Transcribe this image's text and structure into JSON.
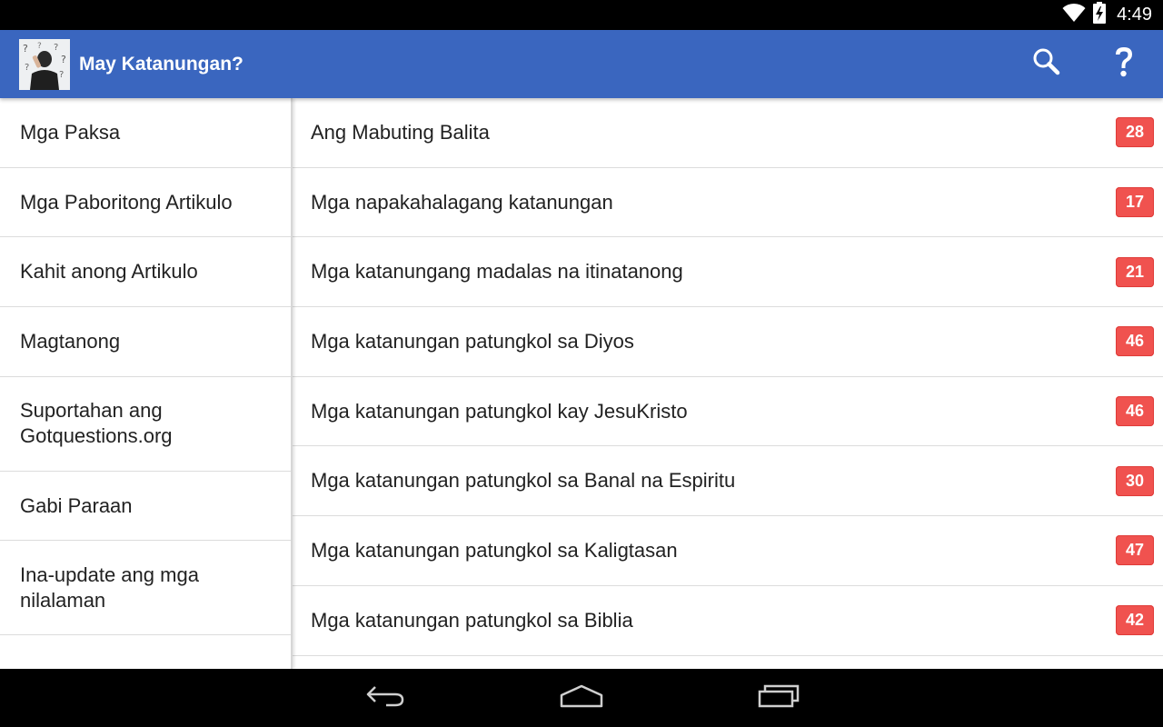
{
  "status_bar": {
    "time": "4:49",
    "icons": [
      "wifi-icon",
      "battery-charging-icon"
    ]
  },
  "action_bar": {
    "title": "May Katanungan?",
    "logo": "app-logo-man-question-marks",
    "actions": [
      "search-icon",
      "help-icon"
    ],
    "color": "#3a66bf"
  },
  "sidebar": {
    "items": [
      {
        "label": "Mga Paksa"
      },
      {
        "label": "Mga Paboritong Artikulo"
      },
      {
        "label": "Kahit anong Artikulo"
      },
      {
        "label": "Magtanong"
      },
      {
        "label": "Suportahan ang Gotquestions.org"
      },
      {
        "label": "Gabi Paraan"
      },
      {
        "label": "Ina-update ang mga nilalaman"
      }
    ]
  },
  "topics": [
    {
      "label": "Ang Mabuting Balita",
      "count": "28"
    },
    {
      "label": "Mga napakahalagang katanungan",
      "count": "17"
    },
    {
      "label": "Mga katanungang madalas na itinatanong",
      "count": "21"
    },
    {
      "label": "Mga katanungan patungkol sa Diyos",
      "count": "46"
    },
    {
      "label": "Mga katanungan patungkol kay JesuKristo",
      "count": "46"
    },
    {
      "label": "Mga katanungan patungkol sa Banal na Espiritu",
      "count": "30"
    },
    {
      "label": "Mga katanungan patungkol sa Kaligtasan",
      "count": "47"
    },
    {
      "label": "Mga katanungan patungkol sa Biblia",
      "count": "42"
    }
  ],
  "badge_color": "#f0524f",
  "nav_bar": {
    "buttons": [
      "back-icon",
      "home-icon",
      "recent-apps-icon"
    ]
  }
}
